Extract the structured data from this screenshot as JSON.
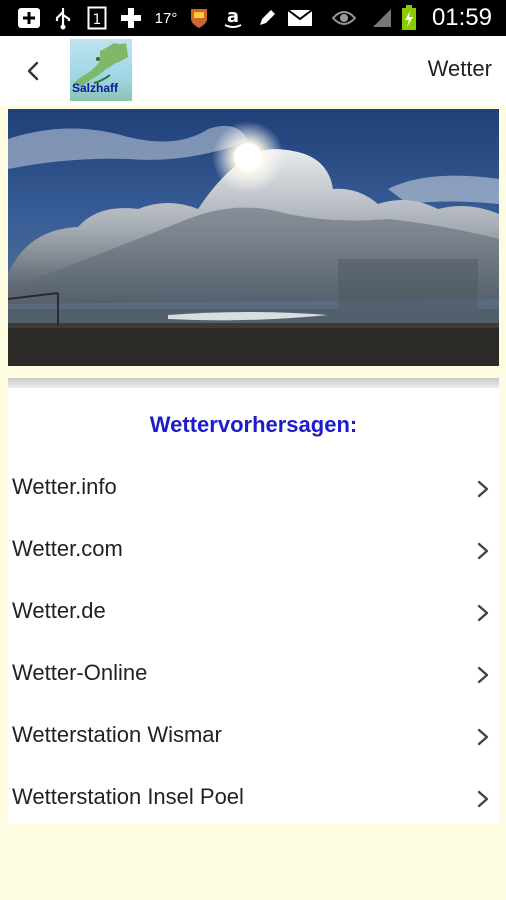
{
  "status_bar": {
    "time": "01:59",
    "temperature": "17°",
    "icons": [
      "add-box-icon",
      "usb-icon",
      "sim-1-icon",
      "game-controller-icon",
      "weather-icon",
      "shield-badge-icon",
      "amazon-icon",
      "pencil-icon",
      "mail-icon",
      "eye-icon",
      "signal-icon",
      "battery-charging-icon"
    ]
  },
  "action_bar": {
    "logo_text": "Salzhaff",
    "title": "Wetter"
  },
  "main": {
    "section_title": "Wettervorhersagen:",
    "items": [
      {
        "label": "Wetter.info"
      },
      {
        "label": "Wetter.com"
      },
      {
        "label": "Wetter.de"
      },
      {
        "label": "Wetter-Online"
      },
      {
        "label": "Wetterstation Wismar"
      },
      {
        "label": "Wetterstation Insel Poel"
      }
    ]
  },
  "colors": {
    "background": "#fdfbe0",
    "section_title": "#1c1cc8",
    "status_bar": "#000000"
  }
}
